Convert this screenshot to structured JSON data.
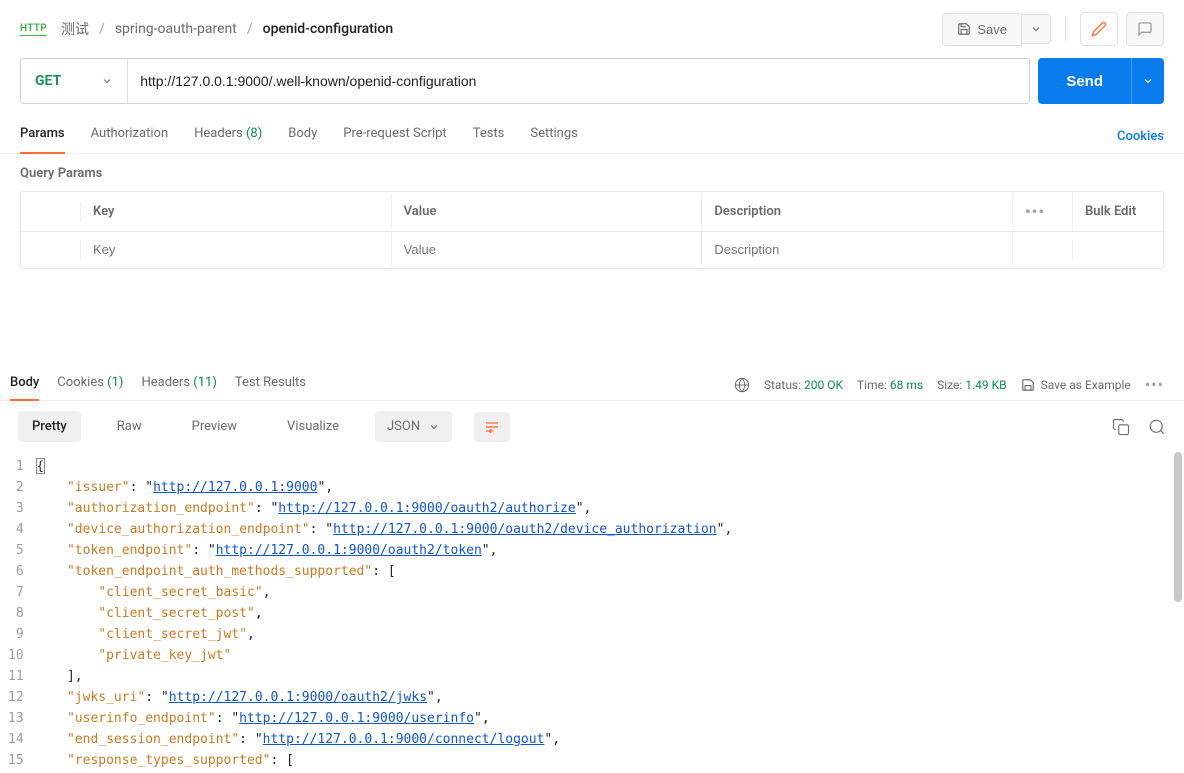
{
  "breadcrumb": {
    "root": "测试",
    "path1": "spring-oauth-parent",
    "current": "openid-configuration"
  },
  "http_badge": "HTTP",
  "save_label": "Save",
  "method": "GET",
  "url": "http://127.0.0.1:9000/.well-known/openid-configuration",
  "send_label": "Send",
  "req_tabs": {
    "params": "Params",
    "auth": "Authorization",
    "headers": "Headers",
    "headers_count": "(8)",
    "body": "Body",
    "prereq": "Pre-request Script",
    "tests": "Tests",
    "settings": "Settings"
  },
  "cookies_link": "Cookies",
  "query_params_title": "Query Params",
  "params_table": {
    "key": "Key",
    "value": "Value",
    "desc": "Description",
    "key_ph": "Key",
    "value_ph": "Value",
    "desc_ph": "Description",
    "bulk": "Bulk Edit"
  },
  "resp_tabs": {
    "body": "Body",
    "cookies": "Cookies",
    "cookies_count": "(1)",
    "headers": "Headers",
    "headers_count": "(11)",
    "tests": "Test Results"
  },
  "resp_meta": {
    "status_lbl": "Status:",
    "status_val": "200 OK",
    "time_lbl": "Time:",
    "time_val": "68 ms",
    "size_lbl": "Size:",
    "size_val": "1.49 KB",
    "save_example": "Save as Example"
  },
  "fmt": {
    "pretty": "Pretty",
    "raw": "Raw",
    "preview": "Preview",
    "visualize": "Visualize",
    "lang": "JSON"
  },
  "code_lines": [
    "{",
    "    \"issuer\": \"http://127.0.0.1:9000\",",
    "    \"authorization_endpoint\": \"http://127.0.0.1:9000/oauth2/authorize\",",
    "    \"device_authorization_endpoint\": \"http://127.0.0.1:9000/oauth2/device_authorization\",",
    "    \"token_endpoint\": \"http://127.0.0.1:9000/oauth2/token\",",
    "    \"token_endpoint_auth_methods_supported\": [",
    "        \"client_secret_basic\",",
    "        \"client_secret_post\",",
    "        \"client_secret_jwt\",",
    "        \"private_key_jwt\"",
    "    ],",
    "    \"jwks_uri\": \"http://127.0.0.1:9000/oauth2/jwks\",",
    "    \"userinfo_endpoint\": \"http://127.0.0.1:9000/userinfo\",",
    "    \"end_session_endpoint\": \"http://127.0.0.1:9000/connect/logout\",",
    "    \"response_types_supported\": ["
  ]
}
